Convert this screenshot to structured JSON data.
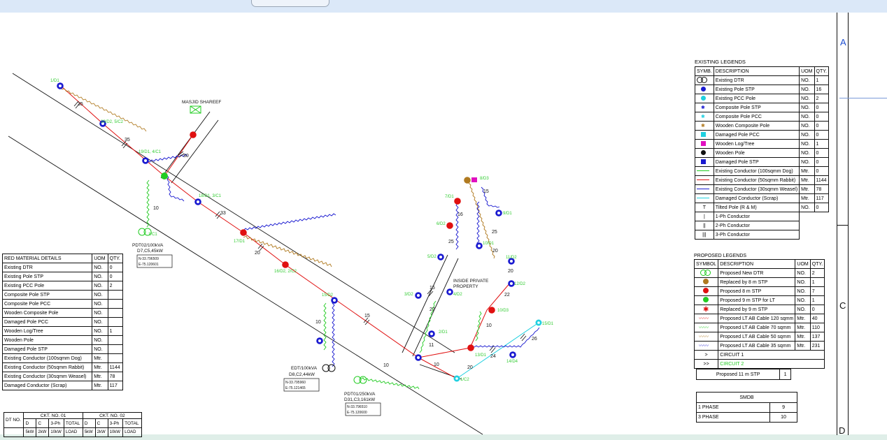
{
  "frame_letters": {
    "a": "A",
    "c": "C",
    "d": "D"
  },
  "map_labels": {
    "masjid": "MASJID SHAREEF",
    "inside_private": "INSIDE PRIVATE",
    "property": "PROPERTY",
    "pdt02_name": "PDT02/100kVA",
    "pdt02_detail": "D7,C5,45kW",
    "pdt02_n": "N-33.796509",
    "pdt02_e": "E-75.120601",
    "edt_name": "EDT/100kVA",
    "edt_detail": "D8,C2,44kW",
    "edt_n": "N-33.795960",
    "edt_e": "E-75.121465",
    "pdt01_name": "PDT01/250kVA",
    "pdt01_detail": "D31,C3,161kW",
    "pdt01_n": "N-33.796510",
    "pdt01_e": "E-75.120600"
  },
  "pole_labels": [
    "1/D1",
    "20/D2, 5/C2",
    "19/D1, 4/C1",
    "18/D1, 3/C1",
    "17/D1",
    "16/D2, 2/C2",
    "15/D2",
    "3/D2",
    "4/D2",
    "2/D1",
    "5/D2",
    "6/D2",
    "7/D1",
    "8/D3",
    "9/D1",
    "10/D1",
    "11/D2",
    "12/D2",
    "10/D3",
    "13/D1",
    "14/D4",
    "15/D1",
    "1/C1",
    "1/C2"
  ],
  "span_labels": [
    "35",
    "35",
    "30",
    "10",
    "33",
    "20",
    "15",
    "10",
    "10",
    "15",
    "27",
    "11",
    "25",
    "16",
    "15",
    "25",
    "20",
    "20",
    "22",
    "10",
    "24",
    "26",
    "20",
    "10"
  ],
  "existing_legend": {
    "title": "EXISTING LEGENDS",
    "headers": [
      "SYMB.",
      "DESCRIPTION",
      "UOM",
      "QTY."
    ],
    "rows": [
      {
        "desc": "Existing DTR",
        "uom": "NO.",
        "qty": "1"
      },
      {
        "desc": "Existing Pole STP",
        "uom": "NO.",
        "qty": "16"
      },
      {
        "desc": "Existing PCC Pole",
        "uom": "NO.",
        "qty": "2"
      },
      {
        "desc": "Composite Pole STP",
        "uom": "NO.",
        "qty": "0"
      },
      {
        "desc": "Composite Pole PCC",
        "uom": "NO.",
        "qty": "0"
      },
      {
        "desc": "Wooden Composite Pole",
        "uom": "NO.",
        "qty": "0"
      },
      {
        "desc": "Damaged Pole PCC",
        "uom": "NO.",
        "qty": "0"
      },
      {
        "desc": "Wooden Log/Tree",
        "uom": "NO.",
        "qty": "1"
      },
      {
        "desc": "Wooden Pole",
        "uom": "NO.",
        "qty": "0"
      },
      {
        "desc": "Damaged Pole STP",
        "uom": "NO.",
        "qty": "0"
      },
      {
        "desc": "Existing Conductor (100sqmm Dog)",
        "uom": "Mtr.",
        "qty": "0"
      },
      {
        "desc": "Existing Conductor (50sqmm Rabbit)",
        "uom": "Mtr.",
        "qty": "1144"
      },
      {
        "desc": "Existing Conductor (30sqmm Weasel)",
        "uom": "Mtr.",
        "qty": "78"
      },
      {
        "desc": "Damaged Conductor (Scrap)",
        "uom": "Mtr.",
        "qty": "117"
      },
      {
        "desc": "Tilted Pole (R & M)",
        "uom": "NO.",
        "qty": "0"
      },
      {
        "desc": "1-Ph Conductor",
        "uom": "",
        "qty": ""
      },
      {
        "desc": "2-Ph Conductor",
        "uom": "",
        "qty": ""
      },
      {
        "desc": "3-Ph Conductor",
        "uom": "",
        "qty": ""
      }
    ],
    "symbol_t": "T",
    "symbol_1": "|",
    "symbol_2": "||",
    "symbol_3": "|||"
  },
  "proposed_legend": {
    "title": "PROPOSED LEGENDS",
    "headers": [
      "SYMBOL",
      "DESCRIPTION",
      "UOM",
      "QTY."
    ],
    "rows": [
      {
        "desc": "Proposed New DTR",
        "uom": "NO.",
        "qty": "2"
      },
      {
        "desc": "Replaced by 8 m STP",
        "uom": "NO.",
        "qty": "1"
      },
      {
        "desc": "Proposed 8 m STP",
        "uom": "NO.",
        "qty": "7"
      },
      {
        "desc": "Proposed 9 m STP for LT",
        "uom": "NO.",
        "qty": "1"
      },
      {
        "desc": "Replaced by 9 m STP",
        "uom": "NO.",
        "qty": "0"
      },
      {
        "desc": "Proposed LT AB Cable 120 sqmm",
        "uom": "Mtr.",
        "qty": "40"
      },
      {
        "desc": "Proposed LT AB Cable 70 sqmm",
        "uom": "Mtr.",
        "qty": "110"
      },
      {
        "desc": "Proposed LT AB Cable 50 sqmm",
        "uom": "Mtr.",
        "qty": "137"
      },
      {
        "desc": "Proposed LT AB Cable 35 sqmm",
        "uom": "Mtr.",
        "qty": "231"
      },
      {
        "desc": "CIRCUIT 1",
        "uom": "",
        "qty": ""
      },
      {
        "desc": "CIRCUIT 2",
        "uom": "",
        "qty": ""
      }
    ],
    "stp11_label": "Proposed 11 m STP",
    "stp11_qty": "1"
  },
  "smdb": {
    "title": "SMDB",
    "rows": [
      {
        "label": "1 PHASE",
        "value": "9"
      },
      {
        "label": "3 PHASE",
        "value": "10"
      }
    ]
  },
  "red_material": {
    "headers": [
      "RED MATERIAL DETAILS",
      "UOM",
      "QTY."
    ],
    "rows": [
      {
        "desc": "Existing DTR",
        "uom": "NO.",
        "qty": "0"
      },
      {
        "desc": "Existing Pole STP",
        "uom": "NO.",
        "qty": "0"
      },
      {
        "desc": "Existing PCC Pole",
        "uom": "NO.",
        "qty": "2"
      },
      {
        "desc": "Composite Pole STP",
        "uom": "NO.",
        "qty": ""
      },
      {
        "desc": "Composite Pole PCC",
        "uom": "NO.",
        "qty": ""
      },
      {
        "desc": "Wooden Composite Pole",
        "uom": "NO.",
        "qty": ""
      },
      {
        "desc": "Damaged Pole PCC",
        "uom": "NO.",
        "qty": ""
      },
      {
        "desc": "Wooden Log/Tree",
        "uom": "NO.",
        "qty": "1"
      },
      {
        "desc": "Wooden Pole",
        "uom": "NO.",
        "qty": ""
      },
      {
        "desc": "Damaged Pole STP",
        "uom": "NO.",
        "qty": ""
      },
      {
        "desc": "Existing Conductor (100sqmm Dog)",
        "uom": "Mtr.",
        "qty": ""
      },
      {
        "desc": "Existing Conductor (50sqmm Rabbit)",
        "uom": "Mtr.",
        "qty": "1144"
      },
      {
        "desc": "Existing Conductor (30sqmm Weasel)",
        "uom": "Mtr.",
        "qty": "78"
      },
      {
        "desc": "Damaged Conductor (Scrap)",
        "uom": "Mtr.",
        "qty": "117"
      }
    ]
  },
  "ckt_table": {
    "ckt1": "CKT. NO. 01",
    "ckt2": "CKT. NO. 02",
    "dt_no": "DT NO.",
    "d": "D",
    "c": "C",
    "three_ph": "3-Ph",
    "total": "TOTAL",
    "load": "LOAD",
    "kw5": "5kW",
    "kw2": "2kW",
    "kw10": "10kW"
  },
  "colors": {
    "red": "#e01010",
    "green": "#22cc22",
    "blue": "#1a1ad0",
    "brown": "#b07a20",
    "cyan": "#20d0e0",
    "label_green": "#33cc33"
  }
}
